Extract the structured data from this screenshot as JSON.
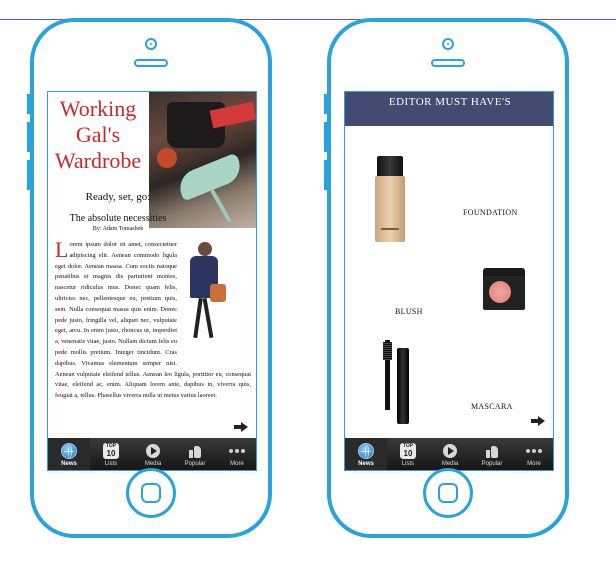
{
  "left_screen": {
    "title": "Working Gal's Wardrobe",
    "subtitle": "Ready, set, go:",
    "subtitle2": "The absolute necessities",
    "byline": "By: Adam Tomashek",
    "dropcap": "L",
    "body": "orem ipsum dolor sit amet, consectetuer adipiscing elit. Aenean commodo ligula eget dolor. Aenean massa. Cum sociis natoque penatibus et magnis dis parturient montes, nascetur ridiculus mus. Donec quam felis, ultricies nec, pellentesque eu, pretium quis, sem. Nulla consequat massa quis enim. Donec pede justo, fringilla vel, aliquet nec, vulputate eget, arcu. In enim justo, rhoncus ut, imperdiet a, venenatis vitae, justo. Nullam dictum felis eu pede mollis pretium. Integer tincidunt. Cras dapibus. Vivamus elementum semper nisi. Aenean vulputate eleifend tellus. Aenean leo ligula, porttitor eu, consequat vitae, eleifend ac, enim. Aliquam lorem ante, dapibus in, viverra quis, feugiat a, tellus. Phasellus viverra nulla ut metus varius laoreet."
  },
  "right_screen": {
    "header": "EDITOR MUST HAVE'S",
    "products": {
      "foundation": "FOUNDATION",
      "blush": "BLUSH",
      "mascara": "MASCARA"
    }
  },
  "tabbar": {
    "news": "News",
    "lists": "Lists",
    "media": "Media",
    "popular": "Popular",
    "more": "More",
    "top10_small": "TOP",
    "top10_big": "10"
  },
  "colors": {
    "frame": "#2aa3dc",
    "title_red": "#c8282c",
    "header_navy": "#434b72"
  }
}
